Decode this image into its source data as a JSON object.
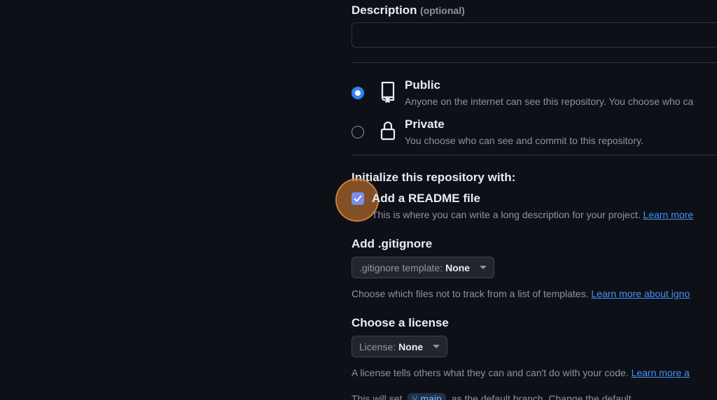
{
  "description": {
    "label": "Description",
    "optional_label": "(optional)",
    "value": ""
  },
  "visibility": {
    "options": [
      {
        "title": "Public",
        "description": "Anyone on the internet can see this repository. You choose who ca",
        "selected": true,
        "icon": "repo-icon"
      },
      {
        "title": "Private",
        "description": "You choose who can see and commit to this repository.",
        "selected": false,
        "icon": "lock-icon"
      }
    ]
  },
  "initialize": {
    "heading": "Initialize this repository with:",
    "readme": {
      "label": "Add a README file",
      "checked": true,
      "description": "This is where you can write a long description for your project.",
      "link": "Learn more"
    }
  },
  "gitignore": {
    "heading": "Add .gitignore",
    "select_prefix": ".gitignore template:",
    "select_value": "None",
    "hint": "Choose which files not to track from a list of templates.",
    "hint_link": "Learn more about igno"
  },
  "license": {
    "heading": "Choose a license",
    "select_prefix": "License:",
    "select_value": "None",
    "hint": "A license tells others what they can and can't do with your code.",
    "hint_link": "Learn more a"
  },
  "branch_note": {
    "prefix": "This will set",
    "branch": "main",
    "suffix": "as the default branch. Change the default"
  },
  "colors": {
    "background": "#0d1117",
    "accent": "#2f81f7",
    "link": "#4493f8",
    "checkbox": "#7b8cf0",
    "click_highlight": "#cc7832"
  }
}
